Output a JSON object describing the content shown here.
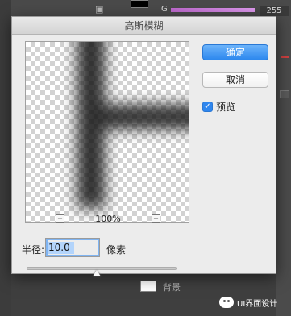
{
  "background": {
    "channel_label": "G",
    "channel_value": "255",
    "layer_name": "背景"
  },
  "dialog": {
    "title": "高斯模糊",
    "ok_label": "确定",
    "cancel_label": "取消",
    "preview_label": "预览",
    "preview_checked": true,
    "zoom_out_symbol": "−",
    "zoom_in_symbol": "+",
    "zoom_level": "100%",
    "radius_label": "半径:",
    "radius_value": "10.0",
    "radius_unit": "像素",
    "radius_slider_fraction": 0.47
  },
  "watermark": {
    "text": "UI界面设计"
  },
  "colors": {
    "accent": "#2f86ee",
    "dialog_bg": "#ececec",
    "app_bg": "#535353"
  }
}
